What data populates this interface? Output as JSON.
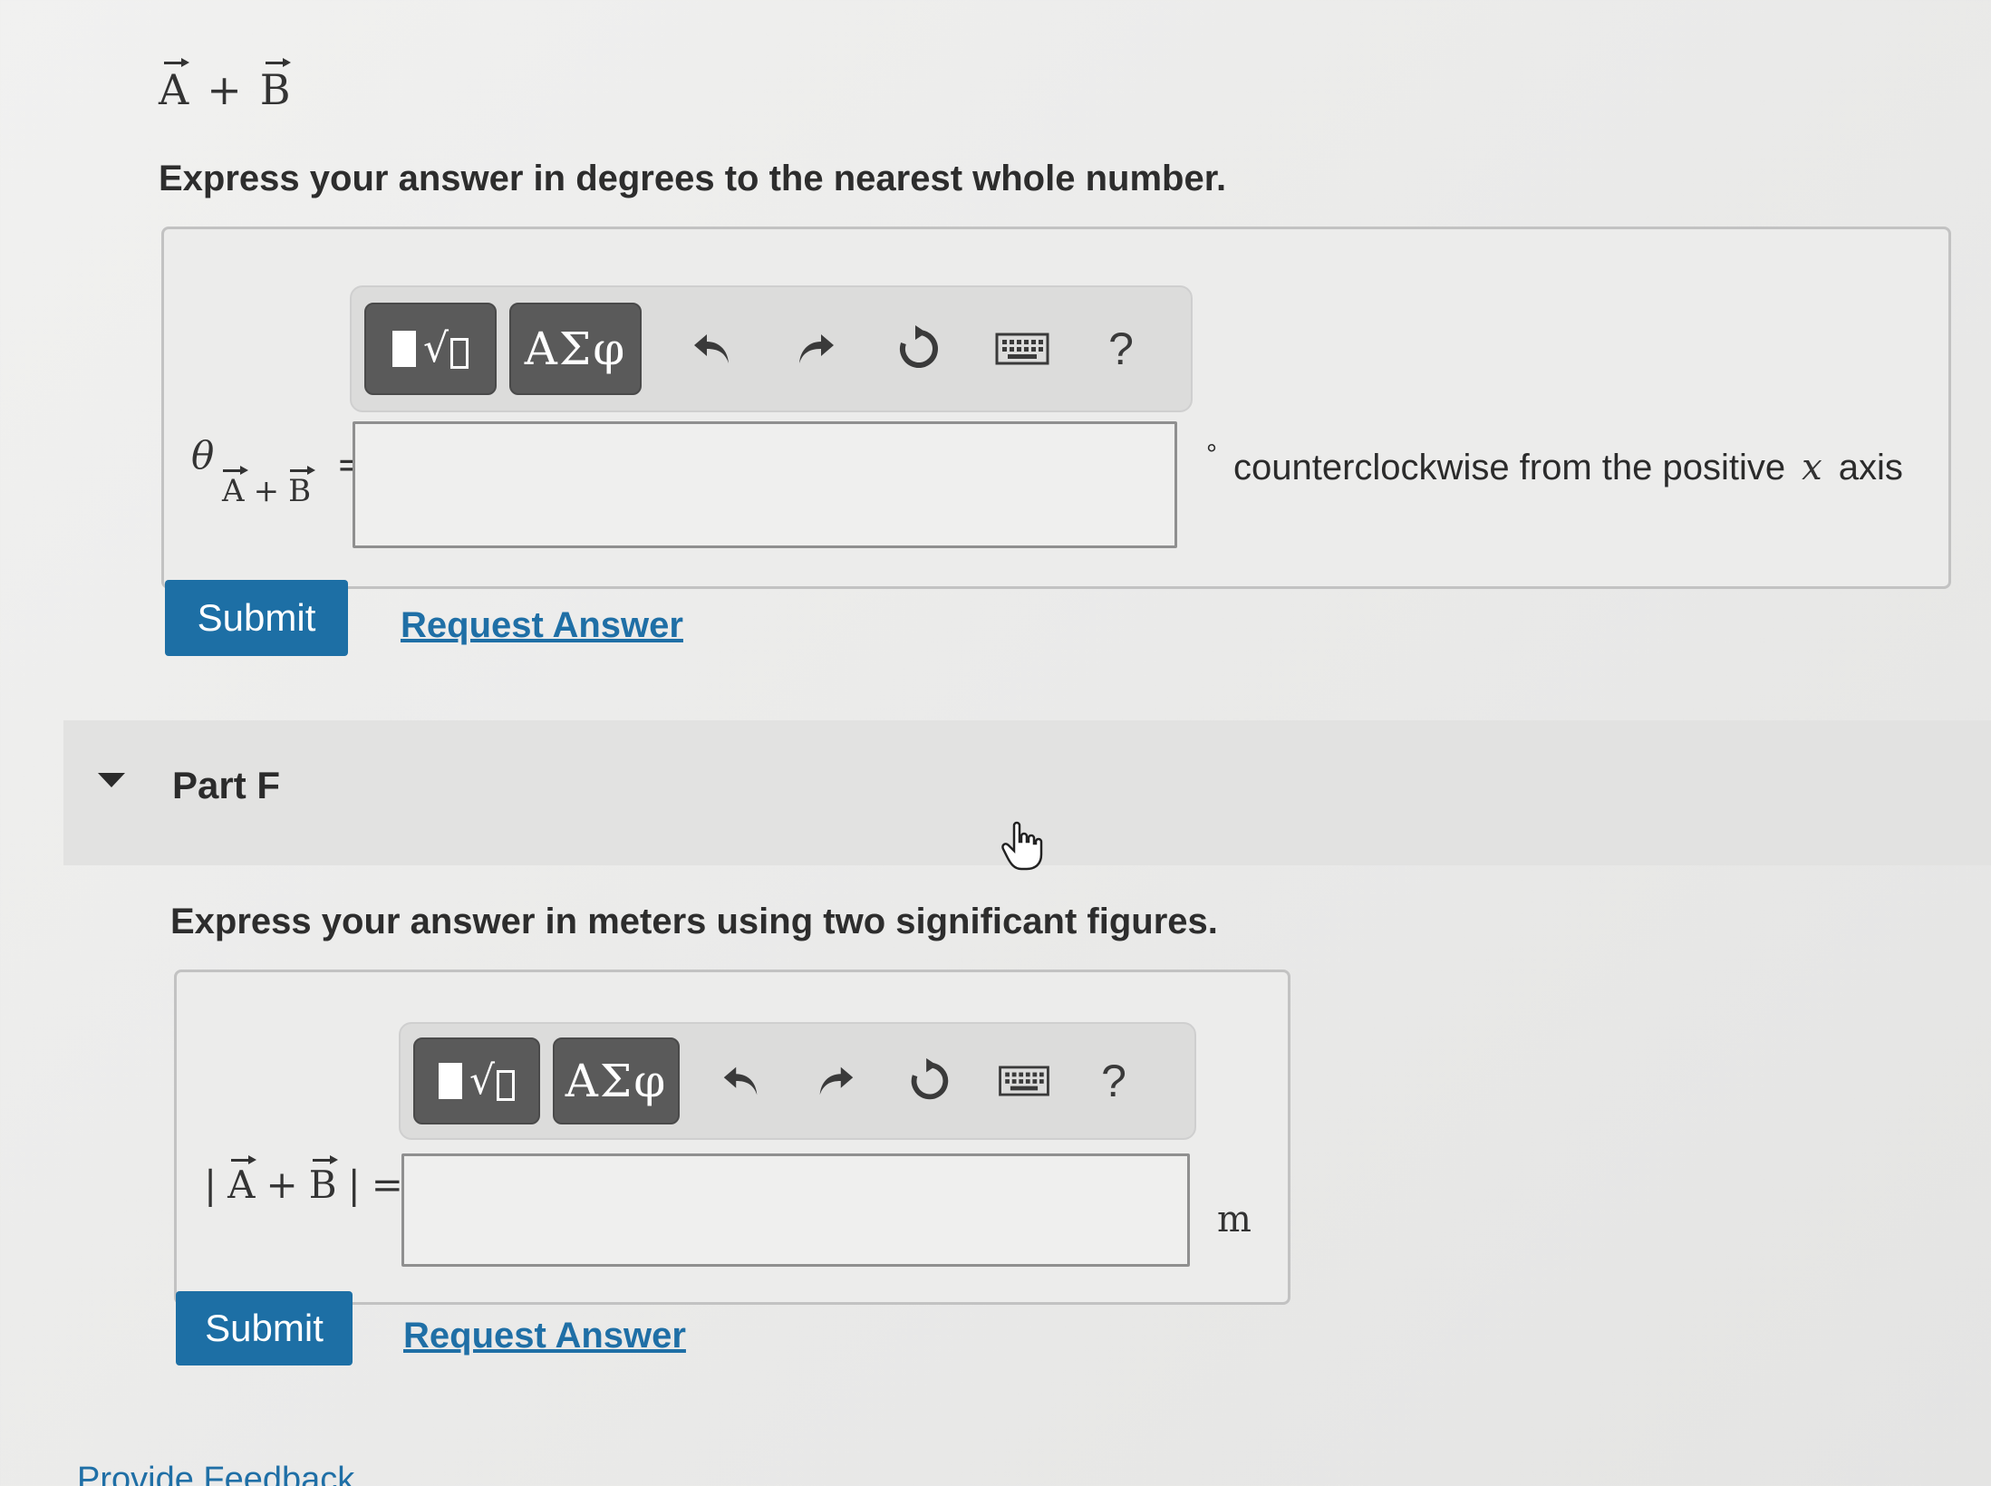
{
  "part_e": {
    "vector_sum": {
      "a": "A",
      "plus": "+",
      "b": "B"
    },
    "instruction": "Express your answer in degrees to the nearest whole number.",
    "label": {
      "theta": "θ",
      "sub_a": "A",
      "sub_plus": "+",
      "sub_b": "B",
      "equals": "="
    },
    "input": {
      "value": "",
      "placeholder": ""
    },
    "unit_symbol": "°",
    "unit_text": "counterclockwise from the positive",
    "unit_var": "x",
    "unit_tail": "axis",
    "submit_label": "Submit",
    "request_label": "Request Answer"
  },
  "toolbar": {
    "greek_label": "ΑΣφ",
    "root_symbol": "√",
    "help_label": "?",
    "icons": [
      "templates-icon",
      "greek-letters-icon",
      "undo-icon",
      "redo-icon",
      "reset-icon",
      "keyboard-icon",
      "help-icon"
    ]
  },
  "part_f": {
    "title": "Part F",
    "instruction": "Express your answer in meters using two significant figures.",
    "label": {
      "bar_open": "|",
      "a": "A",
      "plus": "+",
      "b": "B",
      "bar_close": "|",
      "equals": "="
    },
    "input": {
      "value": "",
      "placeholder": ""
    },
    "unit": "m",
    "submit_label": "Submit",
    "request_label": "Request Answer"
  },
  "footer": {
    "feedback_label": "Provide Feedback"
  },
  "colors": {
    "accent": "#1d6fa5",
    "link": "#1f6fa6",
    "tool_button": "#5a5a5a"
  }
}
